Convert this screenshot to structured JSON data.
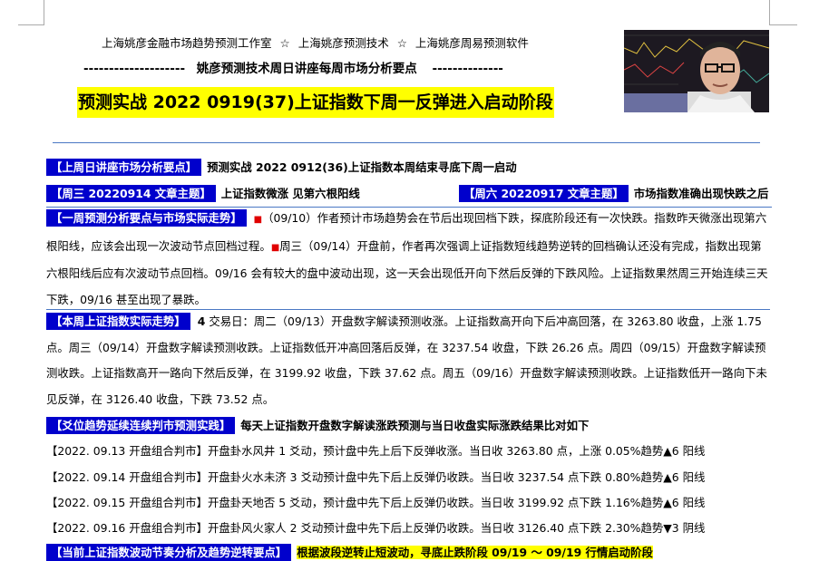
{
  "header": {
    "studio": "上海姚彦金融市场趋势预测工作室",
    "tech": "上海姚彦预测技术",
    "software": "上海姚彦周易预测软件",
    "star": "☆",
    "dash_left": "--------------------",
    "subtitle": "姚彦预测技术周日讲座每周市场分析要点",
    "dash_right": "--------------"
  },
  "title": "预测实战 2022 0919(37)上证指数下周一反弹进入启动阶段",
  "last_week": {
    "tag": "【上周日讲座市场分析要点】",
    "text": "预测实战 2022 0912(36)上证指数本周结束寻底下周一启动"
  },
  "topics": {
    "wed_tag": "【周三 20220914 文章主题】",
    "wed_text": "上证指数微涨  见第六根阳线",
    "sat_tag": "【周六 20220917 文章主题】",
    "sat_text": "市场指数准确出现快跌之后"
  },
  "weekly_review": {
    "tag": "【一周预测分析要点与市场实际走势】",
    "bullet": "■",
    "p1": "（09/10）作者预计市场趋势会在节后出现回档下跌，探底阶段还有一次快跌。指数昨天微涨出现第六根阳线，应该会出现一次波动节点回档过程。",
    "p2": "周三（09/14）开盘前，作者再次强调上证指数短线趋势逆转的回档确认还没有完成，指数出现第六根阳线后应有次波动节点回档。09/16 会有较大的盘中波动出现，这一天会出现低开向下然后反弹的下跌风险。上证指数果然周三开始连续三天下跌，09/16 甚至出现了暴跌。"
  },
  "actual": {
    "tag": "【本周上证指数实际走势】",
    "count": "4",
    "text": "交易日：周二（09/13）开盘数字解读预测收涨。上证指数高开向下后冲高回落，在 3263.80 收盘，上涨 1.75 点。周三（09/14）开盘数字解读预测收跌。上证指数低开冲高回落后反弹，在 3237.54 收盘，下跌 26.26 点。周四（09/15）开盘数字解读预测收跌。上证指数高开一路向下然后反弹，在 3199.92 收盘，下跌 37.62 点。周五（09/16）开盘数字解读预测收跌。上证指数低开一路向下未见反弹，在 3126.40 收盘，下跌 73.52 点。"
  },
  "trend": {
    "tag": "【爻位趋势延续连续判市预测实践】",
    "text": "每天上证指数开盘数字解读涨跌预测与当日收盘实际涨跌结果比对如下",
    "rows": [
      {
        "label": "【2022. 09.13 开盘组合判市】",
        "text": "开盘卦水风井 1 爻动，预计盘中先上后下反弹收涨。当日收 3263.80 点，上涨 0.05%趋势▲6 阳线"
      },
      {
        "label": "【2022. 09.14 开盘组合判市】",
        "text": "开盘卦火水未济 3 爻动预计盘中先下后上反弹仍收跌。当日收 3237.54 点下跌 0.80%趋势▲6 阳线"
      },
      {
        "label": "【2022. 09.15 开盘组合判市】",
        "text": "开盘卦天地否 5 爻动，预计盘中先下后上反弹仍收跌。当日收 3199.92 点下跌 1.16%趋势▲6 阳线"
      },
      {
        "label": "【2022. 09.16 开盘组合判市】",
        "text": "开盘卦风火家人 2 爻动预计盘中先下后上反弹仍收跌。当日收 3126.40 点下跌 2.30%趋势▼3 阴线"
      }
    ]
  },
  "cutoff": {
    "tag": "【当前上证指数波动节奏分析及趋势逆转要点】",
    "text": "根据波段逆转止短波动，寻底止跌阶段 09/19 ～ 09/19 行情启动阶段"
  }
}
